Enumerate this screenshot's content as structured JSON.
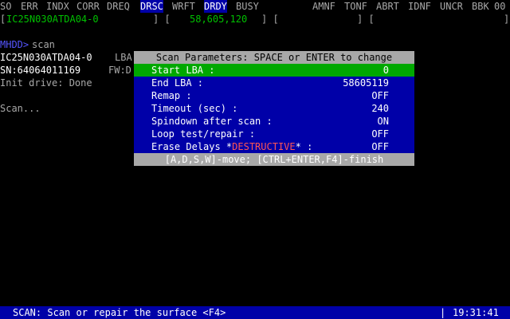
{
  "register_bar": {
    "flags_left": [
      "SO",
      "ERR",
      "INDX",
      "CORR",
      "DREQ"
    ],
    "flag_drsc": "DRSC",
    "flag_wrft": "WRFT",
    "flag_drdy": "DRDY",
    "flag_busy": "BUSY",
    "flags_right": [
      "AMNF",
      "TONF",
      "ABRT",
      "IDNF",
      "UNCR",
      "BBK",
      "00"
    ]
  },
  "info_bar": {
    "model": "IC25N030ATDA04-0",
    "lba_count": "58,605,120"
  },
  "console": {
    "prompt": "MHDD>",
    "command": "scan",
    "model_line": "IC25N030ATDA04-0",
    "lba_prefix": "LBA",
    "serial_line": "SN:64064011169",
    "fw_prefix": "FW:D",
    "init_line": "Init drive: Done",
    "scan_line": "Scan..."
  },
  "dialog": {
    "title": "Scan Parameters: SPACE or ENTER to change",
    "rows": [
      {
        "label": "Start LBA :",
        "value": "0"
      },
      {
        "label": "End LBA :",
        "value": "58605119"
      },
      {
        "label": "Remap :",
        "value": "OFF"
      },
      {
        "label": "Timeout (sec) :",
        "value": "240"
      },
      {
        "label": "Spindown after scan :",
        "value": "ON"
      },
      {
        "label": "Loop test/repair :",
        "value": "OFF"
      }
    ],
    "erase": {
      "label_prefix": "Erase Delays *",
      "label_destructive": "DESTRUCTIVE",
      "label_suffix": "* :",
      "value": "OFF"
    },
    "help": "[A,D,S,W]-move; [CTRL+ENTER,F4]-finish"
  },
  "status_bar": {
    "text": "SCAN: Scan or repair the surface <F4>",
    "separator": "|",
    "time": "19:31:41"
  },
  "colors": {
    "background": "#000000",
    "dialog_body": "#0000a8",
    "dialog_title": "#a8a8a8",
    "selected_row": "#00a800",
    "destructive": "#ff5555",
    "model_text": "#00c000"
  }
}
